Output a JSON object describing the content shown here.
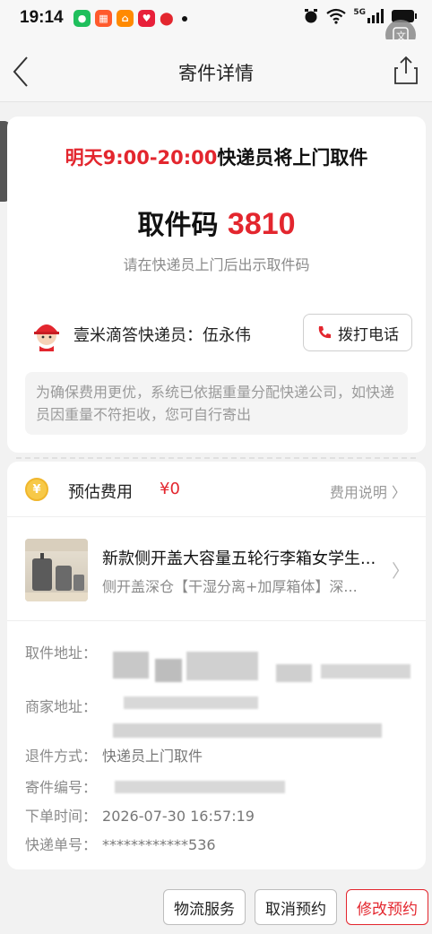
{
  "status_bar": {
    "time": "19:14",
    "network": "5G"
  },
  "nav": {
    "title": "寄件详情"
  },
  "pickup": {
    "time_text": "明天9:00-20:00",
    "suffix_text": "快递员将上门取件",
    "code_label": "取件码",
    "code_value": "3810",
    "code_hint": "请在快递员上门后出示取件码"
  },
  "courier": {
    "name_text": "壹米滴答快递员：伍永伟",
    "call_label": "拨打电话"
  },
  "notice": "为确保费用更优，系统已依据重量分配快递公司，如快递员因重量不符拒收，您可自行寄出",
  "fee": {
    "label": "预估费用",
    "value": "¥0",
    "link": "费用说明",
    "coin_symbol": "¥"
  },
  "item": {
    "title": "新款侧开盖大容量五轮行李箱女学生...",
    "subtitle": "侧开盖深仓【干湿分离+加厚箱体】深..."
  },
  "info": {
    "pickup_address_label": "取件地址：",
    "merchant_address_label": "商家地址：",
    "return_method_label": "退件方式：",
    "return_method_value": "快递员上门取件",
    "shipping_no_label": "寄件编号：",
    "order_time_label": "下单时间：",
    "order_time_value": "2026-07-30 16:57:19",
    "tracking_no_label": "快递单号：",
    "tracking_no_value": "************536"
  },
  "buttons": {
    "logistics": "物流服务",
    "cancel": "取消预约",
    "modify": "修改预约"
  },
  "colors": {
    "accent_red": "#e3262e",
    "gray_text": "#8a8a8a",
    "coin": "#f7c948"
  }
}
